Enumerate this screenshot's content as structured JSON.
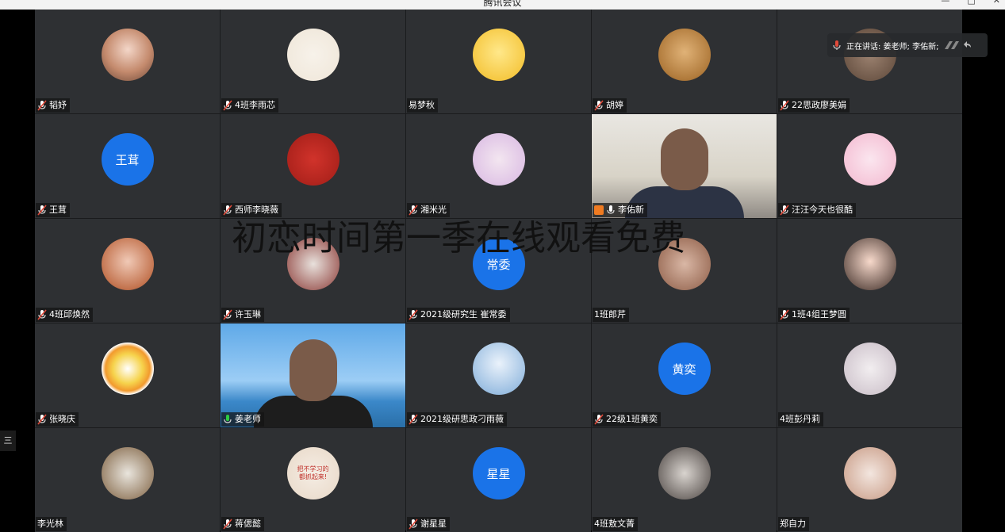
{
  "window": {
    "title": "腾讯会议"
  },
  "speaking_bar": {
    "text": "正在讲话: 姜老师; 李佑新;"
  },
  "overlay_text": "初恋时间第一季在线观看免费",
  "side_button": {
    "label": "三"
  },
  "colors": {
    "tile_bg": "#2e3033",
    "avatar_blue": "#1a73e8",
    "speaking_green": "#2ecc40",
    "muted_red": "#e04a3a"
  },
  "participants": [
    {
      "name": "韬妤",
      "mic": "muted",
      "avatar_type": "photo"
    },
    {
      "name": "4班李雨芯",
      "mic": "muted",
      "avatar_type": "photo"
    },
    {
      "name": "易梦秋",
      "mic": "none",
      "avatar_type": "photo"
    },
    {
      "name": "胡婷",
      "mic": "muted",
      "avatar_type": "photo"
    },
    {
      "name": "22思政廖美娟",
      "mic": "muted",
      "avatar_type": "photo"
    },
    {
      "name": "王茸",
      "mic": "muted",
      "avatar_type": "text",
      "avatar_text": "王茸"
    },
    {
      "name": "西师李晓薇",
      "mic": "muted",
      "avatar_type": "photo"
    },
    {
      "name": "湘米光",
      "mic": "muted",
      "avatar_type": "photo"
    },
    {
      "name": "李佑新",
      "mic": "on",
      "avatar_type": "video",
      "host": true
    },
    {
      "name": "汪汪今天也很酷",
      "mic": "muted",
      "avatar_type": "photo"
    },
    {
      "name": "4班邱焕然",
      "mic": "muted",
      "avatar_type": "photo"
    },
    {
      "name": "许玉琳",
      "mic": "muted",
      "avatar_type": "photo"
    },
    {
      "name": "2021级研究生 崔常委",
      "mic": "muted",
      "avatar_type": "text",
      "avatar_text": "常委"
    },
    {
      "name": "1班郎芹",
      "mic": "none",
      "avatar_type": "photo"
    },
    {
      "name": "1班4组王梦圆",
      "mic": "muted",
      "avatar_type": "photo"
    },
    {
      "name": "张晓庆",
      "mic": "muted",
      "avatar_type": "photo"
    },
    {
      "name": "姜老师",
      "mic": "speaking",
      "avatar_type": "video"
    },
    {
      "name": "2021级研思政刁雨薇",
      "mic": "muted",
      "avatar_type": "photo"
    },
    {
      "name": "22级1班黄奕",
      "mic": "muted",
      "avatar_type": "text",
      "avatar_text": "黄奕"
    },
    {
      "name": "4班彭丹莉",
      "mic": "none",
      "avatar_type": "photo"
    },
    {
      "name": "李光林",
      "mic": "none",
      "avatar_type": "photo"
    },
    {
      "name": "蒋偲懿",
      "mic": "muted",
      "avatar_type": "photo",
      "avatar_caption": "把不学习的都抓起来!"
    },
    {
      "name": "谢星星",
      "mic": "muted",
      "avatar_type": "text",
      "avatar_text": "星星"
    },
    {
      "name": "4班敖文菁",
      "mic": "none",
      "avatar_type": "photo"
    },
    {
      "name": "郑自力",
      "mic": "none",
      "avatar_type": "photo"
    }
  ]
}
